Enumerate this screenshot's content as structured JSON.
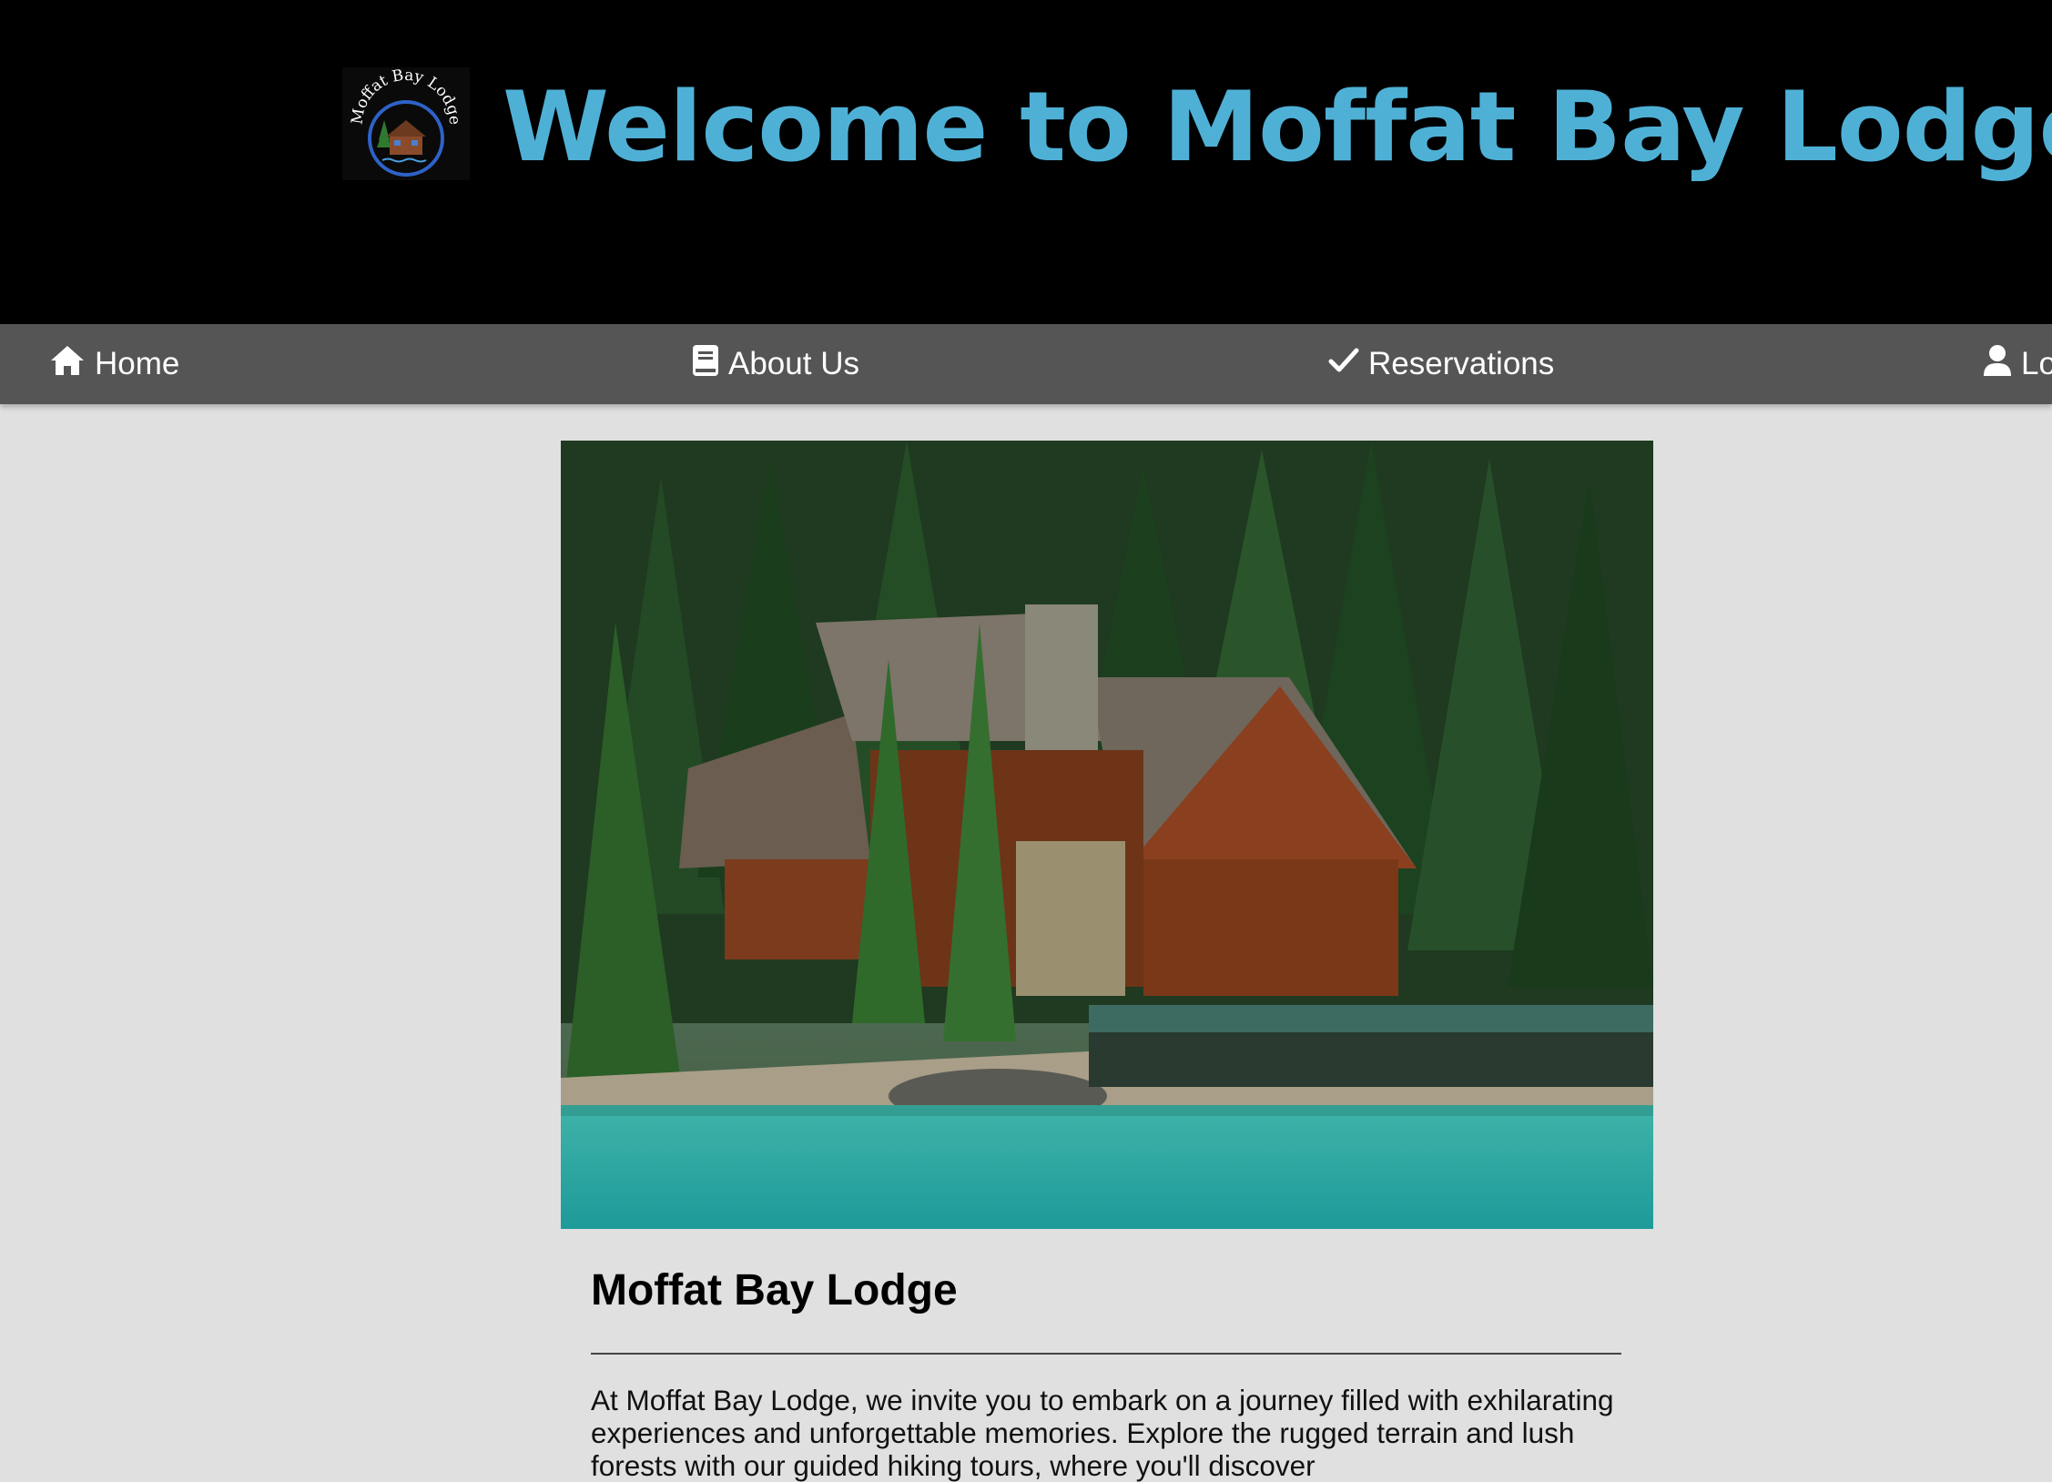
{
  "header": {
    "logo_text": "Moffat Bay Lodge",
    "title": "Welcome to Moffat Bay Lodge"
  },
  "nav": {
    "home": "Home",
    "about": "About Us",
    "reservations": "Reservations",
    "login": "Lo"
  },
  "icons": {
    "home": "home-icon",
    "about": "book-icon",
    "reservations": "check-icon",
    "login": "user-icon"
  },
  "colors": {
    "header_bg": "#000000",
    "title": "#4fb0d6",
    "nav_bg": "#555555",
    "page_bg": "#e0e0e0"
  },
  "main": {
    "title": "Moffat Bay Lodge",
    "intro": "At Moffat Bay Lodge, we invite you to embark on a journey filled with exhilarating experiences and unforgettable memories. Explore the rugged terrain and lush forests with our guided hiking tours, where you'll discover"
  }
}
